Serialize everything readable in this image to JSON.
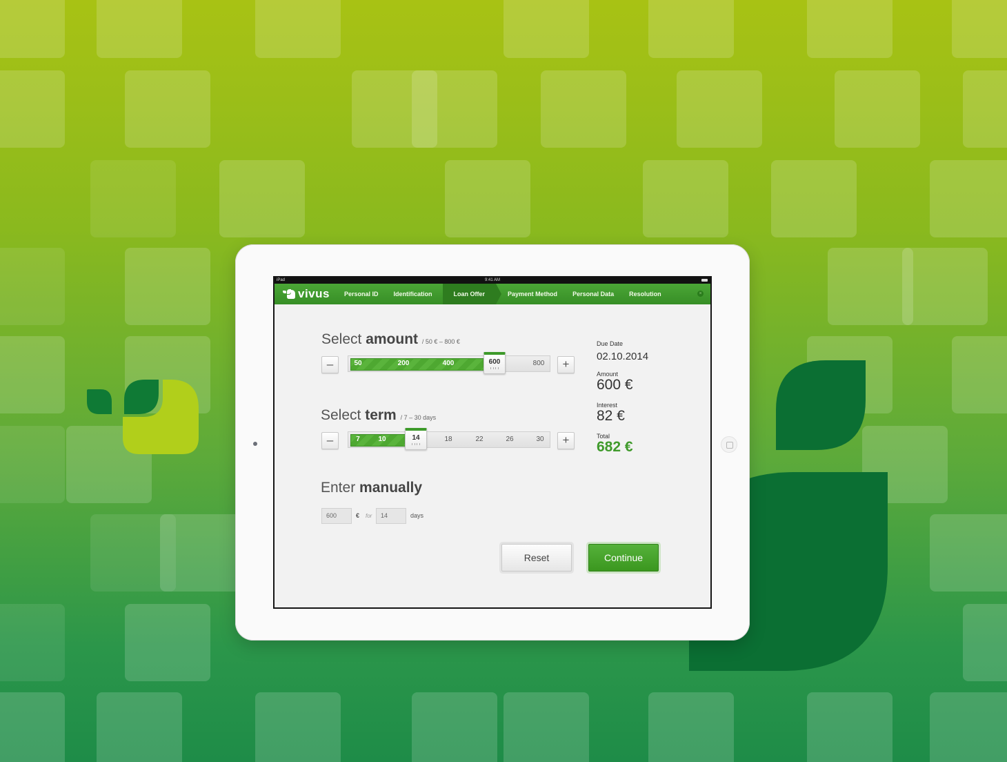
{
  "device": {
    "carrier": "iPad",
    "time": "9:41 AM"
  },
  "brand": {
    "logo_text": "vivus",
    "primary_color": "#3f9a2b",
    "accent_color": "#b1cf1b"
  },
  "nav": {
    "items": [
      {
        "label": "Personal ID"
      },
      {
        "label": "Identification"
      },
      {
        "label": "Loan Offer",
        "active": true
      },
      {
        "label": "Payment Method"
      },
      {
        "label": "Personal Data"
      },
      {
        "label": "Resolution"
      }
    ]
  },
  "amount": {
    "title_prefix": "Select ",
    "title_bold": "amount",
    "range": "/ 50 € – 800 €",
    "minus": "–",
    "plus": "+",
    "ticks": [
      "50",
      "200",
      "400",
      "600",
      "800"
    ],
    "selected": "600"
  },
  "term": {
    "title_prefix": "Select ",
    "title_bold": "term",
    "range": "/ 7 – 30 days",
    "minus": "–",
    "plus": "+",
    "ticks": [
      "7",
      "10",
      "14",
      "18",
      "22",
      "26",
      "30"
    ],
    "selected": "14"
  },
  "manual": {
    "title_prefix": "Enter ",
    "title_bold": "manually",
    "amount_value": "600",
    "currency": "€",
    "for_label": "for",
    "days_value": "14",
    "days_label": "days"
  },
  "summary": {
    "due_date_label": "Due Date",
    "due_date": "02.10.2014",
    "amount_label": "Amount",
    "amount": "600 €",
    "interest_label": "Interest",
    "interest": "82 €",
    "total_label": "Total",
    "total": "682 €"
  },
  "actions": {
    "reset": "Reset",
    "continue": "Continue"
  }
}
